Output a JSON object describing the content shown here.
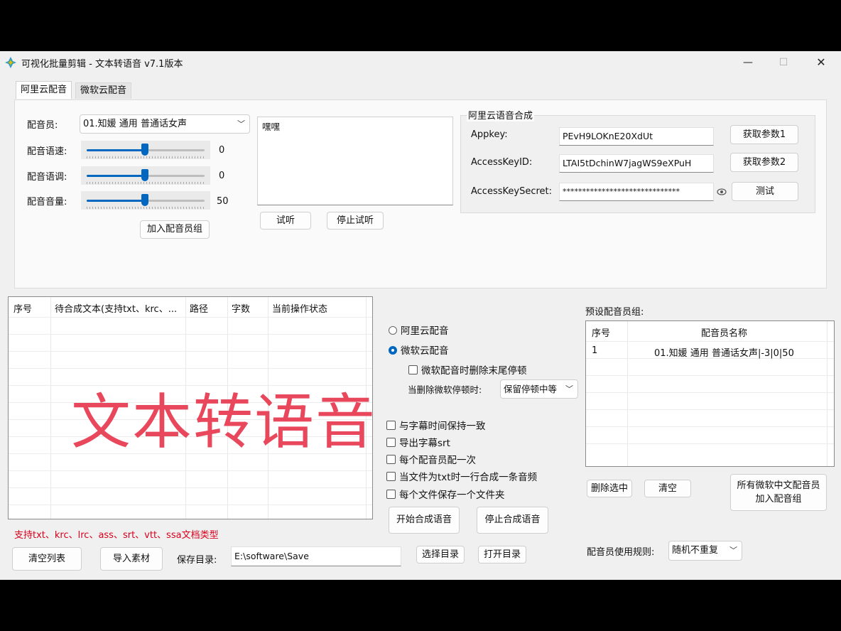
{
  "window": {
    "title": "可视化批量剪辑 - 文本转语音 v7.1版本",
    "minimize": "—",
    "maximize": "☐",
    "close": "✕"
  },
  "tabs": [
    {
      "label": "阿里云配音",
      "active": true
    },
    {
      "label": "微软云配音",
      "active": false
    }
  ],
  "voice": {
    "speaker_label": "配音员:",
    "speaker_value": "01.知媛 通用 普通话女声",
    "speed_label": "配音语速:",
    "speed_value": "0",
    "pitch_label": "配音语调:",
    "pitch_value": "0",
    "volume_label": "配音音量:",
    "volume_value": "50",
    "add_group_button": "加入配音员组",
    "preview_text": "嘿嘿",
    "listen_button": "试听",
    "stop_listen_button": "停止试听"
  },
  "aliyun": {
    "group_title": "阿里云语音合成",
    "appkey_label": "Appkey:",
    "appkey_value": "PEvH9LOKnE20XdUt",
    "accesskeyid_label": "AccessKeyID:",
    "accesskeyid_value": "LTAI5tDchinW7jagWS9eXPuH",
    "secret_label": "AccessKeySecret:",
    "secret_value": "******************************",
    "get_param1_button": "获取参数1",
    "get_param2_button": "获取参数2",
    "test_button": "测试"
  },
  "file_table": {
    "headers": [
      "序号",
      "待合成文本(支持txt、krc、...",
      "路径",
      "字数",
      "当前操作状态"
    ],
    "overlay_text": "文本转语音",
    "support_note": "支持txt、krc、lrc、ass、srt、vtt、ssa文档类型"
  },
  "options": {
    "radio_aliyun": "阿里云配音",
    "radio_microsoft": "微软云配音",
    "selected": "microsoft",
    "ms_remove_pause": "微软配音时删除末尾停顿",
    "pause_label": "当删除微软停顿时:",
    "pause_value": "保留停顿中等",
    "sync_subtitle": "与字幕时间保持一致",
    "export_srt": "导出字幕srt",
    "once_each": "每个配音员配一次",
    "txt_line": "当文件为txt时一行合成一条音频",
    "folder_each": "每个文件保存一个文件夹",
    "start_button": "开始合成语音",
    "stop_button": "停止合成语音"
  },
  "preset": {
    "label": "预设配音员组:",
    "headers": [
      "序号",
      "配音员名称"
    ],
    "rows": [
      {
        "index": "1",
        "name": "01.知媛 通用 普通话女声|-3|0|50"
      }
    ],
    "delete_selected_button": "删除选中",
    "clear_button": "清空",
    "add_all_ms_line1": "所有微软中文配音员",
    "add_all_ms_line2": "加入配音组",
    "rule_label": "配音员使用规则:",
    "rule_value": "随机不重复"
  },
  "bottom": {
    "clear_list_button": "清空列表",
    "import_button": "导入素材",
    "save_dir_label": "保存目录:",
    "save_dir_value": "E:\\software\\Save",
    "choose_dir_button": "选择目录",
    "open_dir_button": "打开目录"
  },
  "colors": {
    "accent": "#0067c0",
    "note_red": "#d8001c",
    "overlay_pink": "#e8475c"
  }
}
